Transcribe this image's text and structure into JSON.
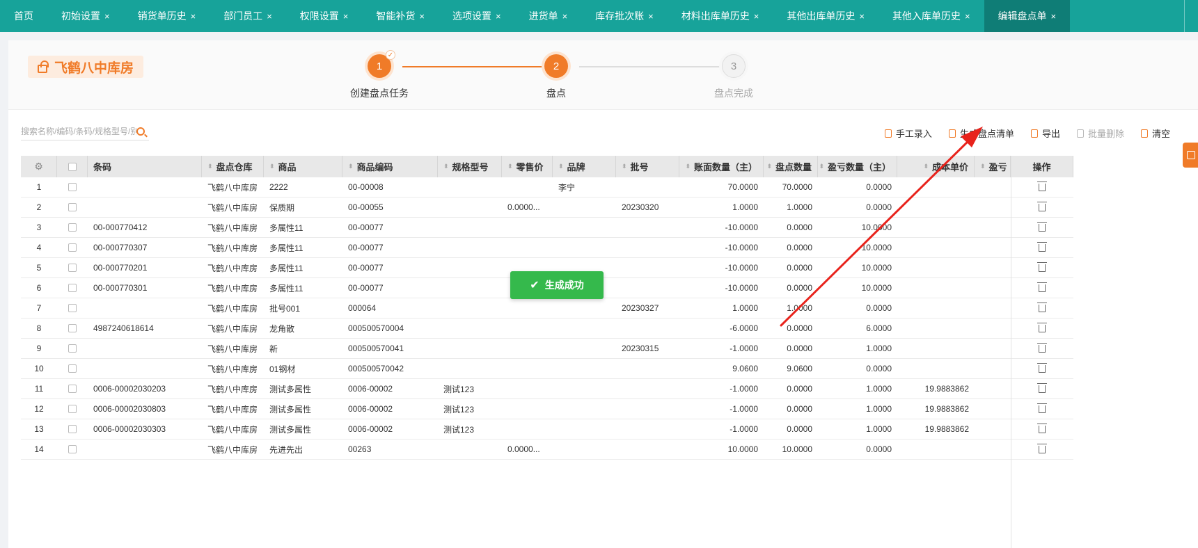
{
  "tabs": [
    {
      "label": "首页",
      "closable": false
    },
    {
      "label": "初始设置",
      "closable": true
    },
    {
      "label": "销货单历史",
      "closable": true
    },
    {
      "label": "部门员工",
      "closable": true
    },
    {
      "label": "权限设置",
      "closable": true
    },
    {
      "label": "智能补货",
      "closable": true
    },
    {
      "label": "选项设置",
      "closable": true
    },
    {
      "label": "进货单",
      "closable": true
    },
    {
      "label": "库存批次账",
      "closable": true
    },
    {
      "label": "材料出库单历史",
      "closable": true
    },
    {
      "label": "其他出库单历史",
      "closable": true
    },
    {
      "label": "其他入库单历史",
      "closable": true
    },
    {
      "label": "编辑盘点单",
      "closable": true,
      "active": true
    }
  ],
  "store": {
    "name": "飞鹤八中库房"
  },
  "steps": [
    {
      "num": "1",
      "label": "创建盘点任务",
      "state": "done"
    },
    {
      "num": "2",
      "label": "盘点",
      "state": "current"
    },
    {
      "num": "3",
      "label": "盘点完成",
      "state": "todo"
    }
  ],
  "search": {
    "placeholder": "搜索名称/编码/条码/规格型号/别名"
  },
  "actions": [
    {
      "label": "手工录入",
      "icon": "clipboard-icon",
      "disabled": false
    },
    {
      "label": "生成盘点清单",
      "icon": "clipboard-check-icon",
      "disabled": false
    },
    {
      "label": "导出",
      "icon": "export-icon",
      "disabled": false
    },
    {
      "label": "批量删除",
      "icon": "copy-icon",
      "disabled": true
    },
    {
      "label": "清空",
      "icon": "broom-icon",
      "disabled": false
    }
  ],
  "table": {
    "columns": [
      "",
      "",
      "条码",
      "盘点仓库",
      "商品",
      "商品编码",
      "规格型号",
      "零售价",
      "品牌",
      "批号",
      "账面数量（主）",
      "盘点数量",
      "盈亏数量（主）",
      "成本单价",
      "盈亏",
      "操作"
    ],
    "rows": [
      [
        "1",
        "",
        "飞鹤八中库房",
        "2222",
        "00-00008",
        "",
        "",
        "李宁",
        "",
        "70.0000",
        "70.0000",
        "0.0000",
        ""
      ],
      [
        "2",
        "",
        "飞鹤八中库房",
        "保质期",
        "00-00055",
        "",
        "0.0000...",
        "",
        "20230320",
        "1.0000",
        "1.0000",
        "0.0000",
        ""
      ],
      [
        "3",
        "00-000770412",
        "飞鹤八中库房",
        "多属性11",
        "00-00077",
        "",
        "",
        "",
        "",
        "-10.0000",
        "0.0000",
        "10.0000",
        ""
      ],
      [
        "4",
        "00-000770307",
        "飞鹤八中库房",
        "多属性11",
        "00-00077",
        "",
        "",
        "",
        "",
        "-10.0000",
        "0.0000",
        "10.0000",
        ""
      ],
      [
        "5",
        "00-000770201",
        "飞鹤八中库房",
        "多属性11",
        "00-00077",
        "",
        "",
        "",
        "",
        "-10.0000",
        "0.0000",
        "10.0000",
        ""
      ],
      [
        "6",
        "00-000770301",
        "飞鹤八中库房",
        "多属性11",
        "00-00077",
        "",
        "",
        "",
        "",
        "-10.0000",
        "0.0000",
        "10.0000",
        ""
      ],
      [
        "7",
        "",
        "飞鹤八中库房",
        "批号001",
        "000064",
        "",
        "",
        "",
        "20230327",
        "1.0000",
        "1.0000",
        "0.0000",
        ""
      ],
      [
        "8",
        "4987240618614",
        "飞鹤八中库房",
        "龙角散",
        "000500570004",
        "",
        "",
        "",
        "",
        "-6.0000",
        "0.0000",
        "6.0000",
        ""
      ],
      [
        "9",
        "",
        "飞鹤八中库房",
        "新",
        "000500570041",
        "",
        "",
        "",
        "20230315",
        "-1.0000",
        "0.0000",
        "1.0000",
        ""
      ],
      [
        "10",
        "",
        "飞鹤八中库房",
        "01钢材",
        "000500570042",
        "",
        "",
        "",
        "",
        "9.0600",
        "9.0600",
        "0.0000",
        ""
      ],
      [
        "11",
        "0006-00002030203",
        "飞鹤八中库房",
        "测试多属性",
        "0006-00002",
        "测试123",
        "",
        "",
        "",
        "-1.0000",
        "0.0000",
        "1.0000",
        "19.9883862"
      ],
      [
        "12",
        "0006-00002030803",
        "飞鹤八中库房",
        "测试多属性",
        "0006-00002",
        "测试123",
        "",
        "",
        "",
        "-1.0000",
        "0.0000",
        "1.0000",
        "19.9883862"
      ],
      [
        "13",
        "0006-00002030303",
        "飞鹤八中库房",
        "测试多属性",
        "0006-00002",
        "测试123",
        "",
        "",
        "",
        "-1.0000",
        "0.0000",
        "1.0000",
        "19.9883862"
      ],
      [
        "14",
        "",
        "飞鹤八中库房",
        "先进先出",
        "00263",
        "",
        "0.0000...",
        "",
        "",
        "10.0000",
        "10.0000",
        "0.0000",
        ""
      ]
    ]
  },
  "toast": {
    "message": "生成成功"
  },
  "colors": {
    "tabbar": "#17a39a",
    "tab_active": "#0f7d76",
    "accent": "#f07b28",
    "success": "#35b94c",
    "arrow": "#e8231c"
  }
}
